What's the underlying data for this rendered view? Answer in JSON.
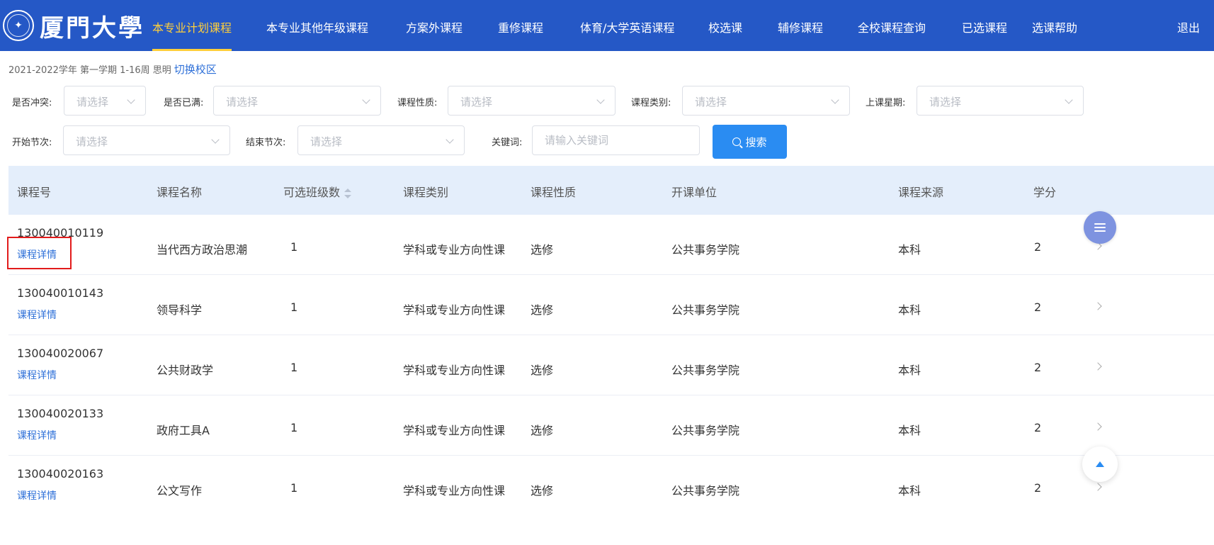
{
  "header": {
    "logo_text": "厦門大學",
    "nav": [
      {
        "label": "本专业计划课程",
        "active": true
      },
      {
        "label": "本专业其他年级课程"
      },
      {
        "label": "方案外课程"
      },
      {
        "label": "重修课程"
      },
      {
        "label": "体育/大学英语课程"
      },
      {
        "label": "校选课"
      },
      {
        "label": "辅修课程"
      },
      {
        "label": "全校课程查询"
      },
      {
        "label": "已选课程"
      },
      {
        "label": "选课帮助"
      },
      {
        "label": "退出"
      }
    ]
  },
  "term": {
    "text": "2021-2022学年 第一学期  1-16周  思明",
    "switch_label": "切换校区"
  },
  "filters": {
    "conflict": {
      "label": "是否冲突:",
      "placeholder": "请选择"
    },
    "full": {
      "label": "是否已满:",
      "placeholder": "请选择"
    },
    "nature": {
      "label": "课程性质:",
      "placeholder": "请选择"
    },
    "category": {
      "label": "课程类别:",
      "placeholder": "请选择"
    },
    "weekday": {
      "label": "上课星期:",
      "placeholder": "请选择"
    },
    "start_period": {
      "label": "开始节次:",
      "placeholder": "请选择"
    },
    "end_period": {
      "label": "结束节次:",
      "placeholder": "请选择"
    },
    "keyword": {
      "label": "关键词:",
      "placeholder": "请输入关键词",
      "value": ""
    },
    "search_label": "搜索"
  },
  "table": {
    "columns": [
      "课程号",
      "课程名称",
      "可选班级数",
      "课程类别",
      "课程性质",
      "开课单位",
      "课程来源",
      "学分"
    ],
    "detail_label": "课程详情",
    "rows": [
      {
        "code": "130040010119",
        "name": "当代西方政治思潮",
        "classes": "1",
        "category": "学科或专业方向性课",
        "nature": "选修",
        "unit": "公共事务学院",
        "source": "本科",
        "credit": "2"
      },
      {
        "code": "130040010143",
        "name": "领导科学",
        "classes": "1",
        "category": "学科或专业方向性课",
        "nature": "选修",
        "unit": "公共事务学院",
        "source": "本科",
        "credit": "2"
      },
      {
        "code": "130040020067",
        "name": "公共财政学",
        "classes": "1",
        "category": "学科或专业方向性课",
        "nature": "选修",
        "unit": "公共事务学院",
        "source": "本科",
        "credit": "2"
      },
      {
        "code": "130040020133",
        "name": "政府工具A",
        "classes": "1",
        "category": "学科或专业方向性课",
        "nature": "选修",
        "unit": "公共事务学院",
        "source": "本科",
        "credit": "2"
      },
      {
        "code": "130040020163",
        "name": "公文写作",
        "classes": "1",
        "category": "学科或专业方向性课",
        "nature": "选修",
        "unit": "公共事务学院",
        "source": "本科",
        "credit": "2"
      }
    ]
  },
  "colors": {
    "nav_bg": "#2558c6",
    "nav_active": "#ffcf3a",
    "link": "#2d6fd8",
    "button": "#2a8cf2",
    "header_row": "#e4eefb",
    "highlight": "#e21b1b"
  }
}
